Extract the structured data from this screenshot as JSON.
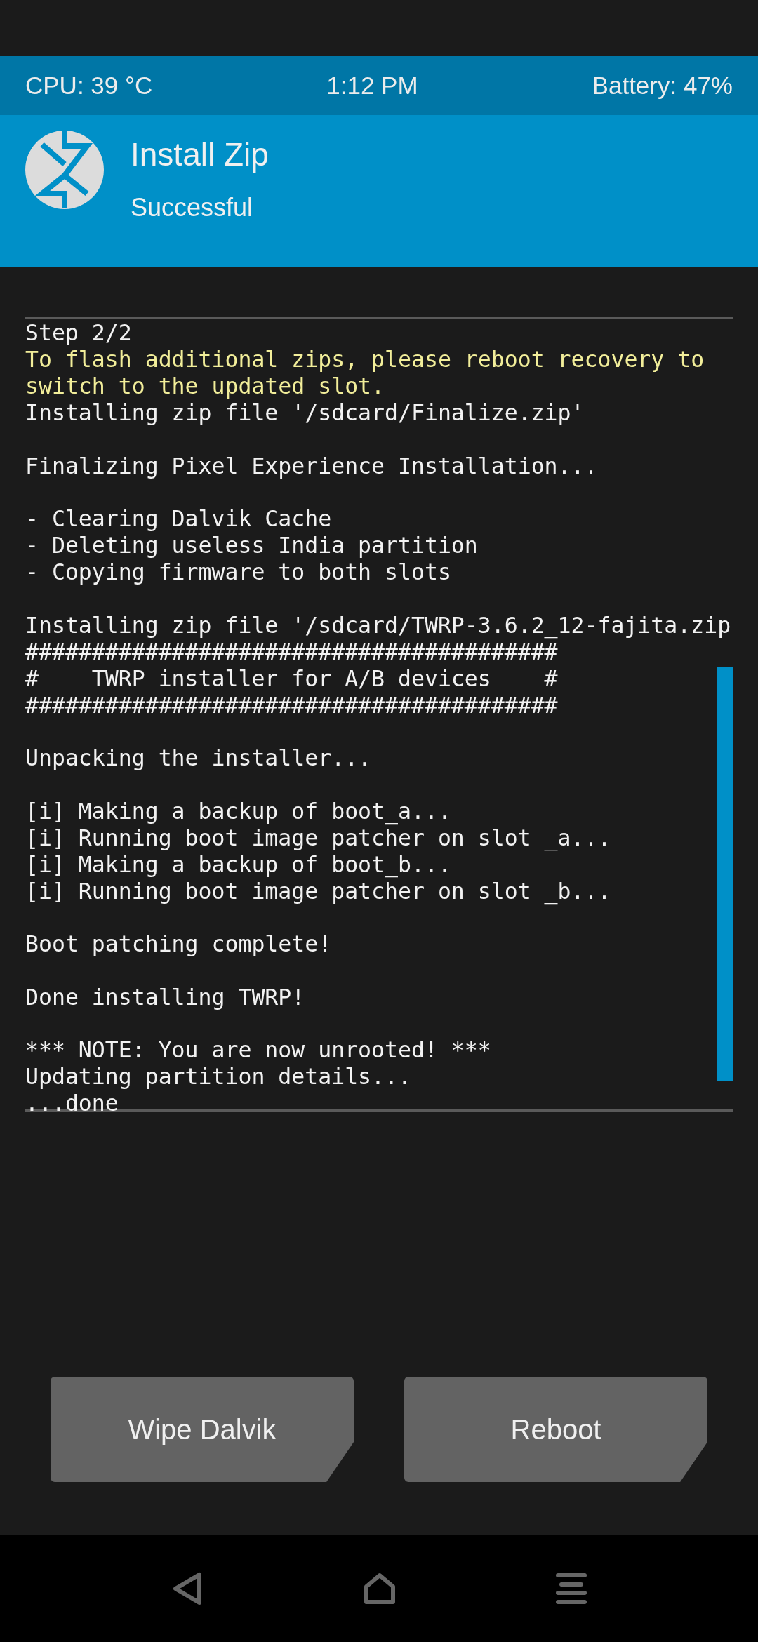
{
  "status_bar": {
    "cpu": "CPU: 39 °C",
    "time": "1:12 PM",
    "battery": "Battery: 47%"
  },
  "header": {
    "title": "Install Zip",
    "subtitle": "Successful"
  },
  "log": [
    {
      "kind": "text",
      "text": "Step 2/2"
    },
    {
      "kind": "warning",
      "text": "To flash additional zips, please reboot recovery to switch to the updated slot."
    },
    {
      "kind": "text",
      "text": "Installing zip file '/sdcard/Finalize.zip'"
    },
    {
      "kind": "blank"
    },
    {
      "kind": "text",
      "text": "Finalizing Pixel Experience Installation..."
    },
    {
      "kind": "blank"
    },
    {
      "kind": "text",
      "text": "- Clearing Dalvik Cache"
    },
    {
      "kind": "text",
      "text": "- Deleting useless India partition"
    },
    {
      "kind": "text",
      "text": "- Copying firmware to both slots"
    },
    {
      "kind": "blank"
    },
    {
      "kind": "text",
      "text": "Installing zip file '/sdcard/TWRP-3.6.2_12-fajita.zip"
    },
    {
      "kind": "text",
      "text": "########################################"
    },
    {
      "kind": "text",
      "text": "#    TWRP installer for A/B devices    #"
    },
    {
      "kind": "text",
      "text": "########################################"
    },
    {
      "kind": "blank"
    },
    {
      "kind": "text",
      "text": "Unpacking the installer..."
    },
    {
      "kind": "blank"
    },
    {
      "kind": "text",
      "text": "[i] Making a backup of boot_a..."
    },
    {
      "kind": "text",
      "text": "[i] Running boot image patcher on slot _a..."
    },
    {
      "kind": "text",
      "text": "[i] Making a backup of boot_b..."
    },
    {
      "kind": "text",
      "text": "[i] Running boot image patcher on slot _b..."
    },
    {
      "kind": "blank"
    },
    {
      "kind": "text",
      "text": "Boot patching complete!"
    },
    {
      "kind": "blank"
    },
    {
      "kind": "text",
      "text": "Done installing TWRP!"
    },
    {
      "kind": "blank"
    },
    {
      "kind": "text",
      "text": "*** NOTE: You are now unrooted! ***"
    },
    {
      "kind": "text",
      "text": "Updating partition details..."
    },
    {
      "kind": "text",
      "text": "...done"
    }
  ],
  "buttons": [
    "Wipe Dalvik",
    "Reboot"
  ]
}
